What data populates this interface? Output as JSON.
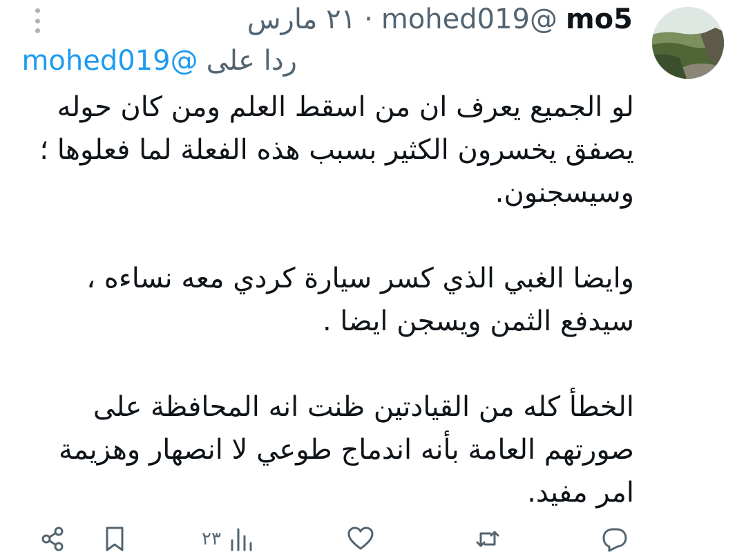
{
  "tweet": {
    "author": {
      "display_name": "mo5",
      "handle": "@mohed019"
    },
    "separator": "·",
    "date": "٢١ مارس",
    "reply": {
      "label": "ردا على",
      "handle": "@mohed019"
    },
    "paragraphs": [
      "لو الجميع يعرف ان من اسقط العلم ومن كان حوله يصفق يخسرون الكثير بسبب هذه الفعلة لما فعلوها ؛ وسيسجنون.",
      "وايضا الغبي الذي كسر سيارة كردي معه نساءه ، سيدفع الثمن ويسجن ايضا .",
      "الخطأ كله من القيادتين ظنت انه المحافظة على صورتهم العامة بأنه اندماج طوعي لا انصهار وهزيمة امر مفيد."
    ],
    "actions": {
      "views": "٢٣"
    }
  },
  "icons": {
    "more": "more-vertical-icon",
    "share": "share-icon",
    "bookmark": "bookmark-icon",
    "views": "views-chart-icon",
    "like": "heart-icon",
    "retweet": "retweet-icon",
    "reply": "reply-icon"
  },
  "colors": {
    "text": "#0f1419",
    "secondary": "#536471",
    "link": "#1d9bf0"
  }
}
